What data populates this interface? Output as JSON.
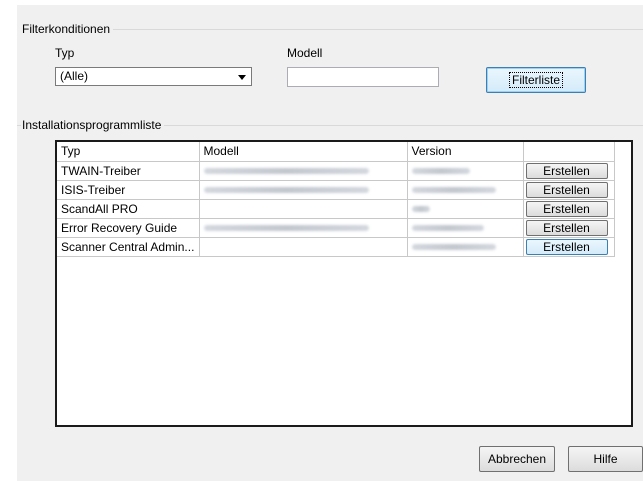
{
  "filter": {
    "group_title": "Filterkonditionen",
    "type_label": "Typ",
    "type_selected": "(Alle)",
    "model_label": "Modell",
    "model_value": "",
    "filter_button": "Filterliste"
  },
  "list": {
    "group_title": "Installationsprogrammliste",
    "columns": [
      "Typ",
      "Modell",
      "Version",
      ""
    ],
    "rows": [
      {
        "type": "TWAIN-Treiber",
        "create": "Erstellen"
      },
      {
        "type": "ISIS-Treiber",
        "create": "Erstellen"
      },
      {
        "type": "ScandAll PRO",
        "create": "Erstellen"
      },
      {
        "type": "Error Recovery Guide",
        "create": "Erstellen"
      },
      {
        "type": "Scanner Central Admin...",
        "create": "Erstellen"
      }
    ]
  },
  "footer": {
    "cancel": "Abbrechen",
    "help": "Hilfe"
  }
}
